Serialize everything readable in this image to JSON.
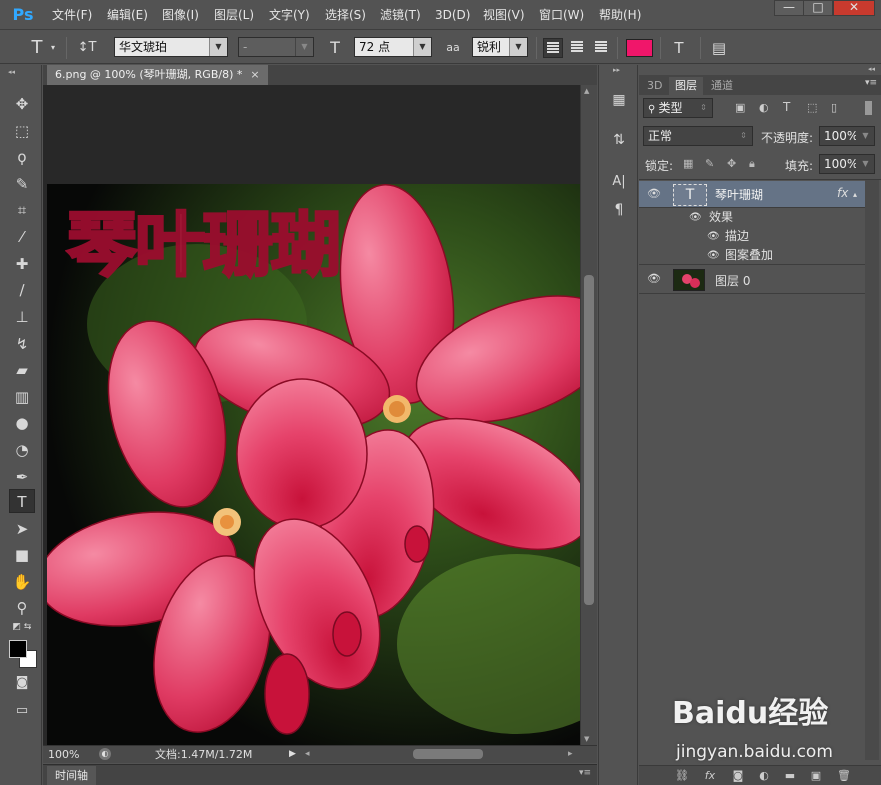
{
  "menubar": {
    "logo": "Ps",
    "items": [
      "文件(F)",
      "编辑(E)",
      "图像(I)",
      "图层(L)",
      "文字(Y)",
      "选择(S)",
      "滤镜(T)",
      "3D(D)",
      "视图(V)",
      "窗口(W)",
      "帮助(H)"
    ],
    "minimize": "—",
    "restore": "□",
    "close": "✕"
  },
  "options": {
    "tool_icon": "T",
    "orient_icon": "↕T",
    "font_family": "华文琥珀",
    "font_style": "-",
    "size_icon": "T",
    "font_size": "72 点",
    "aa_icon": "aa",
    "antialias": "锐利",
    "text_color": "#f0166a",
    "warp_icon": "T",
    "panel_icon": "▤"
  },
  "document": {
    "tab_title": "6.png @ 100% (琴叶珊瑚, RGB/8) *",
    "tab_close": "×",
    "overlay_text": "琴叶珊瑚",
    "zoom": "100%",
    "doc_size": "文档:1.47M/1.72M",
    "timeline_label": "时间轴"
  },
  "strip": {
    "icons": [
      "▦",
      "⇅",
      "A|",
      "¶"
    ]
  },
  "layers_panel": {
    "tabs": [
      "3D",
      "图层",
      "通道"
    ],
    "active_tab": "图层",
    "filter_kind": "类型",
    "blend_mode": "正常",
    "opacity_label": "不透明度:",
    "opacity_value": "100%",
    "lock_label": "锁定:",
    "fill_label": "填充:",
    "fill_value": "100%",
    "layers": [
      {
        "name": "琴叶珊瑚",
        "fx": "fx",
        "thumb": "T",
        "effects_label": "效果",
        "effects": [
          "描边",
          "图案叠加"
        ]
      },
      {
        "name": "图层 0"
      }
    ]
  },
  "watermark": {
    "logo": "Baidu经验",
    "url": "jingyan.baidu.com"
  }
}
